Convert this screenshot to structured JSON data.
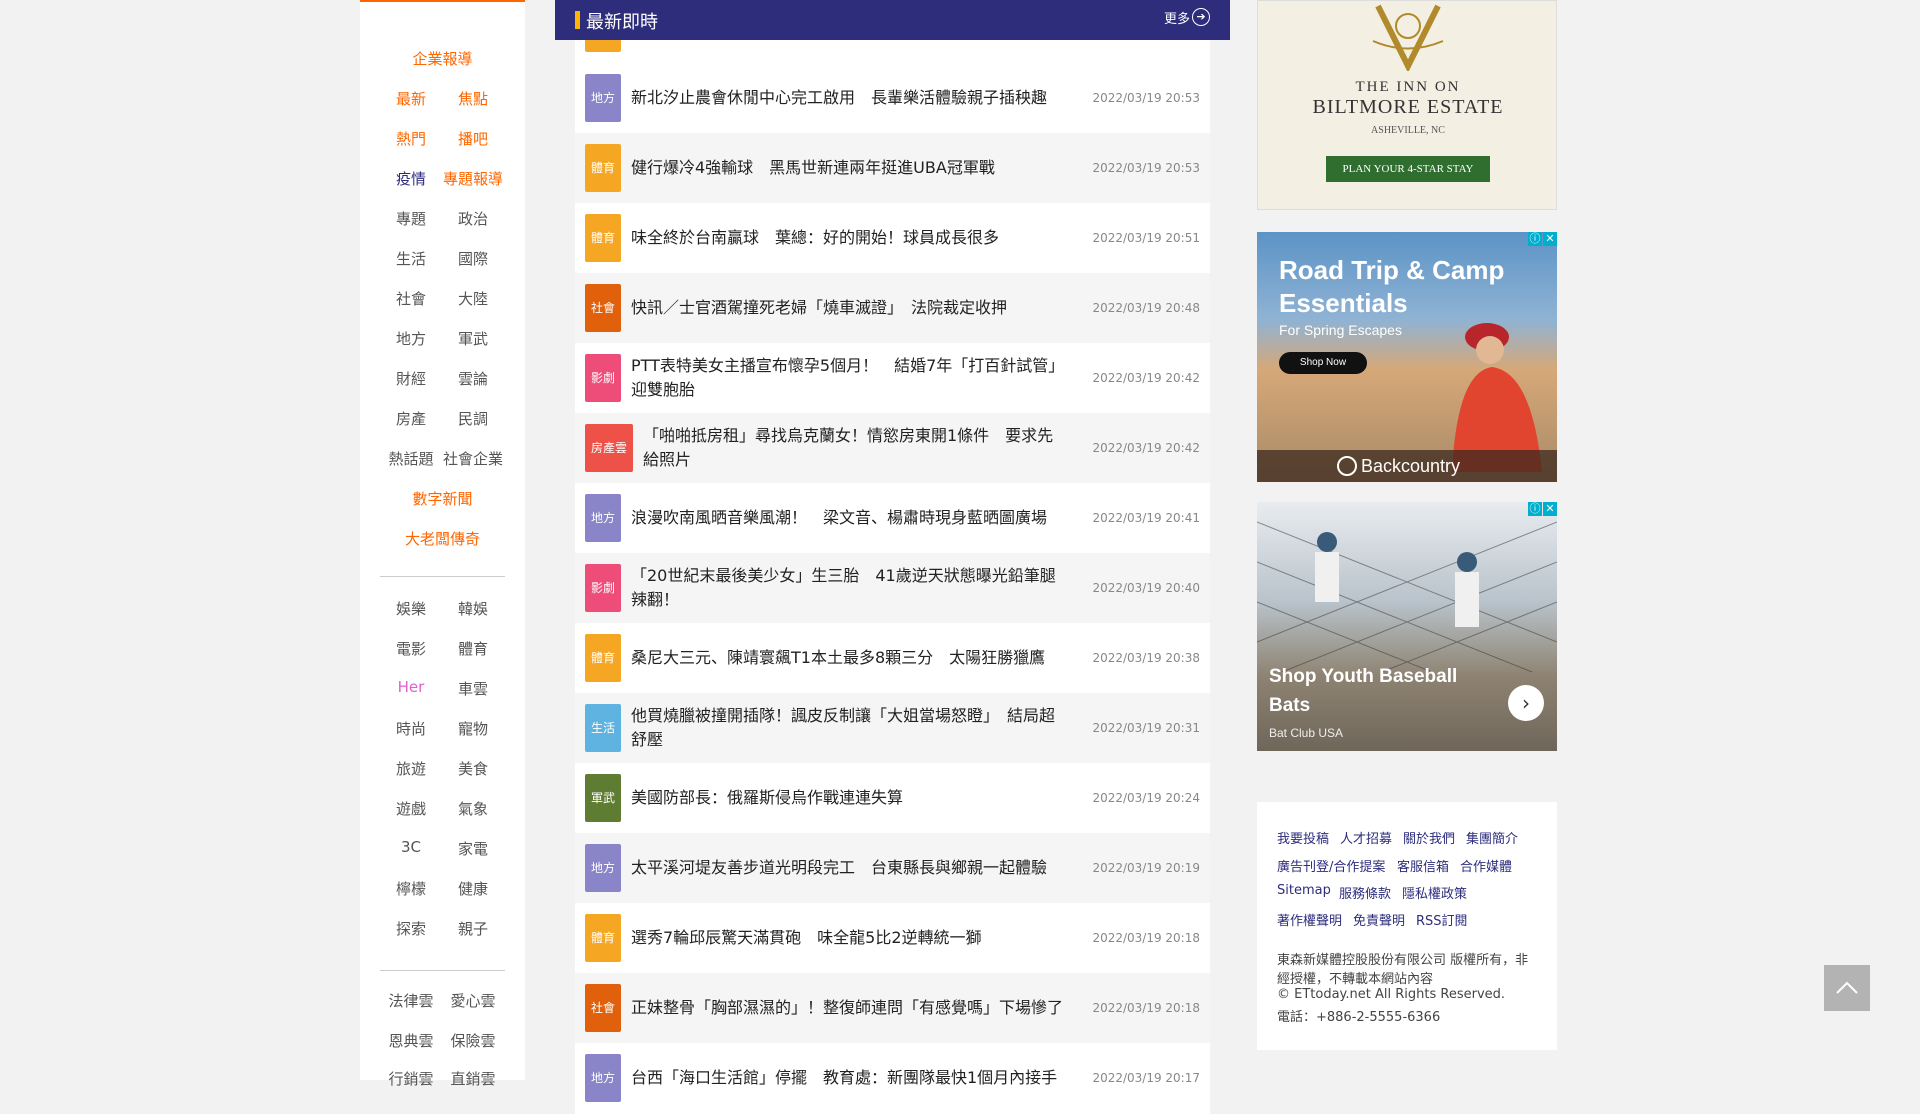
{
  "sidebar": {
    "items": [
      {
        "label": "企業報導",
        "color": "orange"
      },
      {
        "label": "最新",
        "color": "orange"
      },
      {
        "label": "焦點",
        "color": "orange"
      },
      {
        "label": "熱門",
        "color": "orange"
      },
      {
        "label": "播吧",
        "color": "orange"
      },
      {
        "label": "疫情",
        "color": "navy"
      },
      {
        "label": "專題報導",
        "color": "orange"
      },
      {
        "label": "專題",
        "color": "gray"
      },
      {
        "label": "政治",
        "color": "gray"
      },
      {
        "label": "生活",
        "color": "gray"
      },
      {
        "label": "國際",
        "color": "gray"
      },
      {
        "label": "社會",
        "color": "gray"
      },
      {
        "label": "大陸",
        "color": "gray"
      },
      {
        "label": "地方",
        "color": "gray"
      },
      {
        "label": "軍武",
        "color": "gray"
      },
      {
        "label": "財經",
        "color": "gray"
      },
      {
        "label": "雲論",
        "color": "gray"
      },
      {
        "label": "房產",
        "color": "gray"
      },
      {
        "label": "民調",
        "color": "gray"
      },
      {
        "label": "熱話題",
        "color": "gray"
      },
      {
        "label": "社會企業",
        "color": "gray"
      },
      {
        "label": "數字新聞",
        "color": "orange"
      },
      {
        "label": "大老闆傳奇",
        "color": "orange"
      },
      {
        "label": "娛樂",
        "color": "gray"
      },
      {
        "label": "韓娛",
        "color": "gray"
      },
      {
        "label": "電影",
        "color": "gray"
      },
      {
        "label": "體育",
        "color": "gray"
      },
      {
        "label": "Her",
        "color": "pink"
      },
      {
        "label": "車雲",
        "color": "gray"
      },
      {
        "label": "時尚",
        "color": "gray"
      },
      {
        "label": "寵物",
        "color": "gray"
      },
      {
        "label": "旅遊",
        "color": "gray"
      },
      {
        "label": "美食",
        "color": "gray"
      },
      {
        "label": "遊戲",
        "color": "gray"
      },
      {
        "label": "氣象",
        "color": "gray"
      },
      {
        "label": "3C",
        "color": "gray"
      },
      {
        "label": "家電",
        "color": "gray"
      },
      {
        "label": "檸檬",
        "color": "gray"
      },
      {
        "label": "健康",
        "color": "gray"
      },
      {
        "label": "探索",
        "color": "gray"
      },
      {
        "label": "親子",
        "color": "gray"
      },
      {
        "label": "法律雲",
        "color": "gray"
      },
      {
        "label": "愛心雲",
        "color": "gray"
      },
      {
        "label": "恩典雲",
        "color": "gray"
      },
      {
        "label": "保險雲",
        "color": "gray"
      },
      {
        "label": "行銷雲",
        "color": "gray"
      },
      {
        "label": "直銷雲",
        "color": "gray"
      }
    ]
  },
  "news": {
    "title": "最新即時",
    "more_label": "更多",
    "items": [
      {
        "category": "地方",
        "cat_color": "#8a84c8",
        "headline": "新北汐止農會休閒中心完工啟用　長輩樂活體驗親子插秧趣",
        "time": "2022/03/19 20:53"
      },
      {
        "category": "體育",
        "cat_color": "#f5a623",
        "headline": "健行爆冷4強輸球　黑馬世新連兩年挺進UBA冠軍戰",
        "time": "2022/03/19 20:53"
      },
      {
        "category": "體育",
        "cat_color": "#f5a623",
        "headline": "味全終於台南贏球　葉總：好的開始！球員成長很多",
        "time": "2022/03/19 20:51"
      },
      {
        "category": "社會",
        "cat_color": "#e0600c",
        "headline": "快訊／士官酒駕撞死老婦「燒車滅證」　法院裁定收押",
        "time": "2022/03/19 20:48"
      },
      {
        "category": "影劇",
        "cat_color": "#ee4d79",
        "headline": "PTT表特美女主播宣布懷孕5個月！　結婚7年「打百針試管」迎雙胞胎",
        "time": "2022/03/19 20:42"
      },
      {
        "category": "房產雲",
        "cat_color": "#ee5148",
        "headline": "「啪啪抵房租」尋找烏克蘭女！情慾房東開1條件　要求先給照片",
        "time": "2022/03/19 20:42"
      },
      {
        "category": "地方",
        "cat_color": "#8a84c8",
        "headline": "浪漫吹南風晒音樂風潮！　梁文音、楊肅時現身藍晒圖廣場",
        "time": "2022/03/19 20:41"
      },
      {
        "category": "影劇",
        "cat_color": "#ee4d79",
        "headline": "「20世紀末最後美少女」生三胎　41歲逆天狀態曝光鉛筆腿辣翻！",
        "time": "2022/03/19 20:40"
      },
      {
        "category": "體育",
        "cat_color": "#f5a623",
        "headline": "桑尼大三元、陳靖寰飆T1本土最多8顆三分　太陽狂勝獵鷹",
        "time": "2022/03/19 20:38"
      },
      {
        "category": "生活",
        "cat_color": "#5fb3e0",
        "headline": "他買燒臘被撞開插隊！諷皮反制讓「大姐當場怒瞪」　結局超舒壓",
        "time": "2022/03/19 20:31"
      },
      {
        "category": "軍武",
        "cat_color": "#5f7d32",
        "headline": "美國防部長：俄羅斯侵烏作戰連連失算",
        "time": "2022/03/19 20:24"
      },
      {
        "category": "地方",
        "cat_color": "#8a84c8",
        "headline": "太平溪河堤友善步道光明段完工　台東縣長與鄉親一起體驗",
        "time": "2022/03/19 20:19"
      },
      {
        "category": "體育",
        "cat_color": "#f5a623",
        "headline": "選秀7輪邱辰驚天滿貫砲　味全龍5比2逆轉統一獅",
        "time": "2022/03/19 20:18"
      },
      {
        "category": "社會",
        "cat_color": "#e0600c",
        "headline": "正妹整骨「胸部濕濕的」！整復師連問「有感覺嗎」下場慘了",
        "time": "2022/03/19 20:18"
      },
      {
        "category": "地方",
        "cat_color": "#8a84c8",
        "headline": "台西「海口生活館」停擺　教育處：新團隊最快1個月內接手",
        "time": "2022/03/19 20:17"
      }
    ]
  },
  "ads": {
    "inn": {
      "line1": "THE INN ON",
      "line2": "BILTMORE ESTATE",
      "line3": "ASHEVILLE, NC",
      "cta": "PLAN YOUR 4-STAR STAY"
    },
    "backcountry": {
      "title": "Road Trip & Camp Essentials",
      "subtitle": "For Spring Escapes",
      "cta": "Shop Now",
      "brand": "Backcountry"
    },
    "baseball": {
      "title": "Shop Youth Baseball Bats",
      "advertiser": "Bat Club USA"
    }
  },
  "footer": {
    "links_row1": [
      "我要投稿",
      "人才招募",
      "關於我們",
      "集團簡介"
    ],
    "links_row2": [
      "廣告刊登/合作提案",
      "客服信箱",
      "合作媒體"
    ],
    "links_row3": [
      "Sitemap",
      "服務條款",
      "隱私權政策"
    ],
    "links_row4": [
      "著作權聲明",
      "免責聲明",
      "RSS訂閱"
    ],
    "copyright1": "東森新媒體控股股份有限公司 版權所有，非",
    "copyright2": "經授權，不轉載本網站內容",
    "copyright3": "© ETtoday.net All Rights Reserved.",
    "phone": "電話：+886-2-5555-6366"
  }
}
